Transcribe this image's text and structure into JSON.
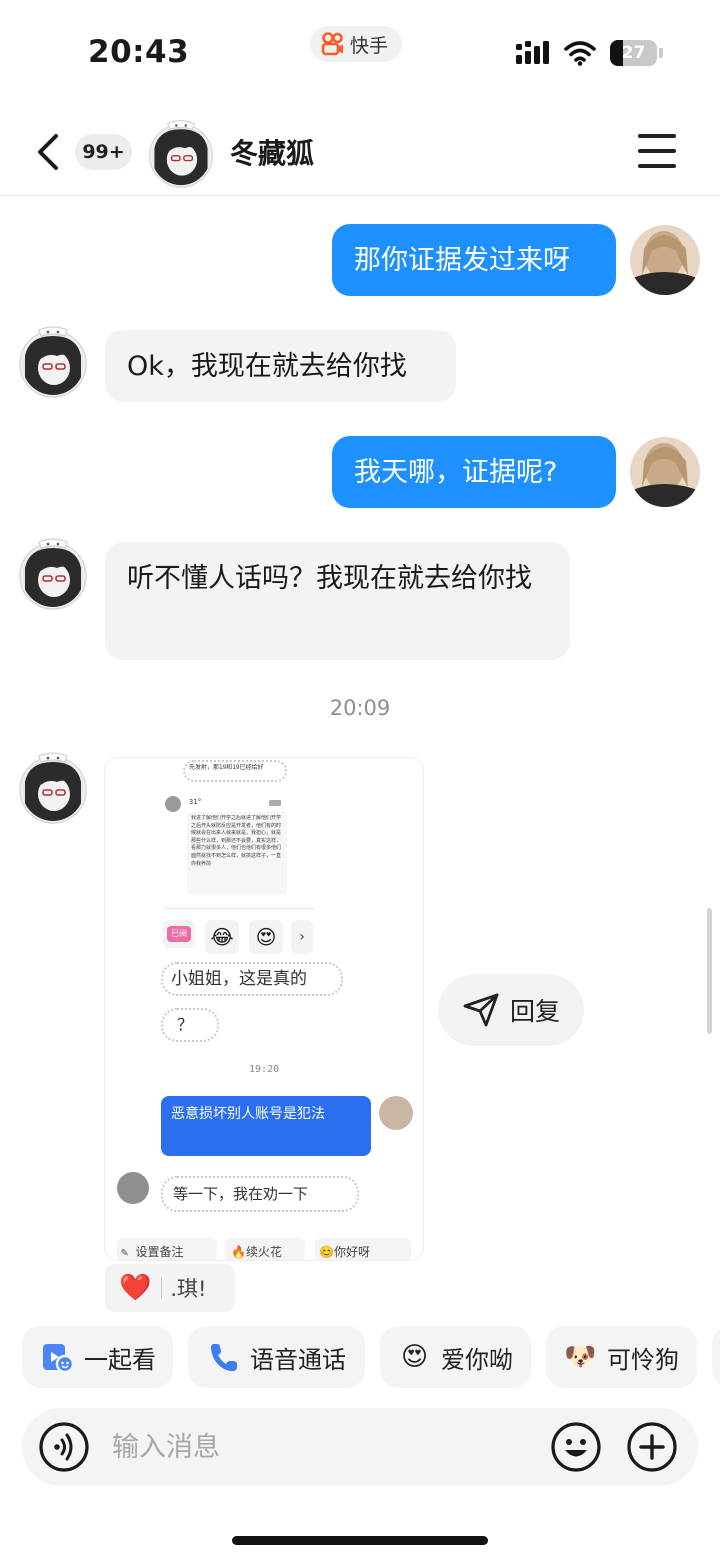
{
  "status_bar": {
    "time": "20:43",
    "app_name": "快手",
    "battery_level": 27,
    "battery_text": "27"
  },
  "header": {
    "unread_count": "99+",
    "contact_name": "冬藏狐"
  },
  "messages": [
    {
      "side": "sent",
      "text": "那你证据发过来呀"
    },
    {
      "side": "recv",
      "text": "Ok，我现在就去给你找"
    },
    {
      "side": "sent",
      "text": "我天哪，证据呢?"
    },
    {
      "side": "recv",
      "text": "听不懂人话吗？我现在就去给你找"
    }
  ],
  "timestamp": "20:09",
  "image_message": {
    "top_note": "先发射，那19和19已经给好",
    "sender_tag": "31°",
    "dense_text": "我进了解他们开学之后就进了解他们开学之后开头就防反应是开发者，他们有的时候就会在出来人就来就是，我担心，就是那些什么样，到那还不会要，真实这样，看那力就很多人，他们也他们有很多他们面然就找不到怎么样，就搞这样子，一直你我养前",
    "tag_1": "已阅",
    "handwritten_1": "小姐姐，这是真的",
    "handwritten_2": "？",
    "inner_time": "19:20",
    "inner_sent": "恶意损坏别人账号是犯法",
    "handwritten_3": "等一下，我在劝一下",
    "bottom_1": "设置备注",
    "bottom_2": "续火花",
    "bottom_3": "你好呀"
  },
  "reply_label": "回复",
  "reaction": {
    "emoji": "❤️",
    "name": ".琪!"
  },
  "quick_actions": [
    {
      "label": "一起看",
      "icon": "watch-together-icon"
    },
    {
      "label": "语音通话",
      "icon": "phone-icon"
    },
    {
      "label": "爱你呦",
      "icon": "love-face-emoji"
    },
    {
      "label": "可怜狗",
      "icon": "pitiful-dog-emoji"
    }
  ],
  "input": {
    "placeholder": "输入消息"
  },
  "colors": {
    "accent": "#1e90ff",
    "bubble_recv": "#f3f3f3",
    "phone_blue": "#3d7cf5"
  }
}
